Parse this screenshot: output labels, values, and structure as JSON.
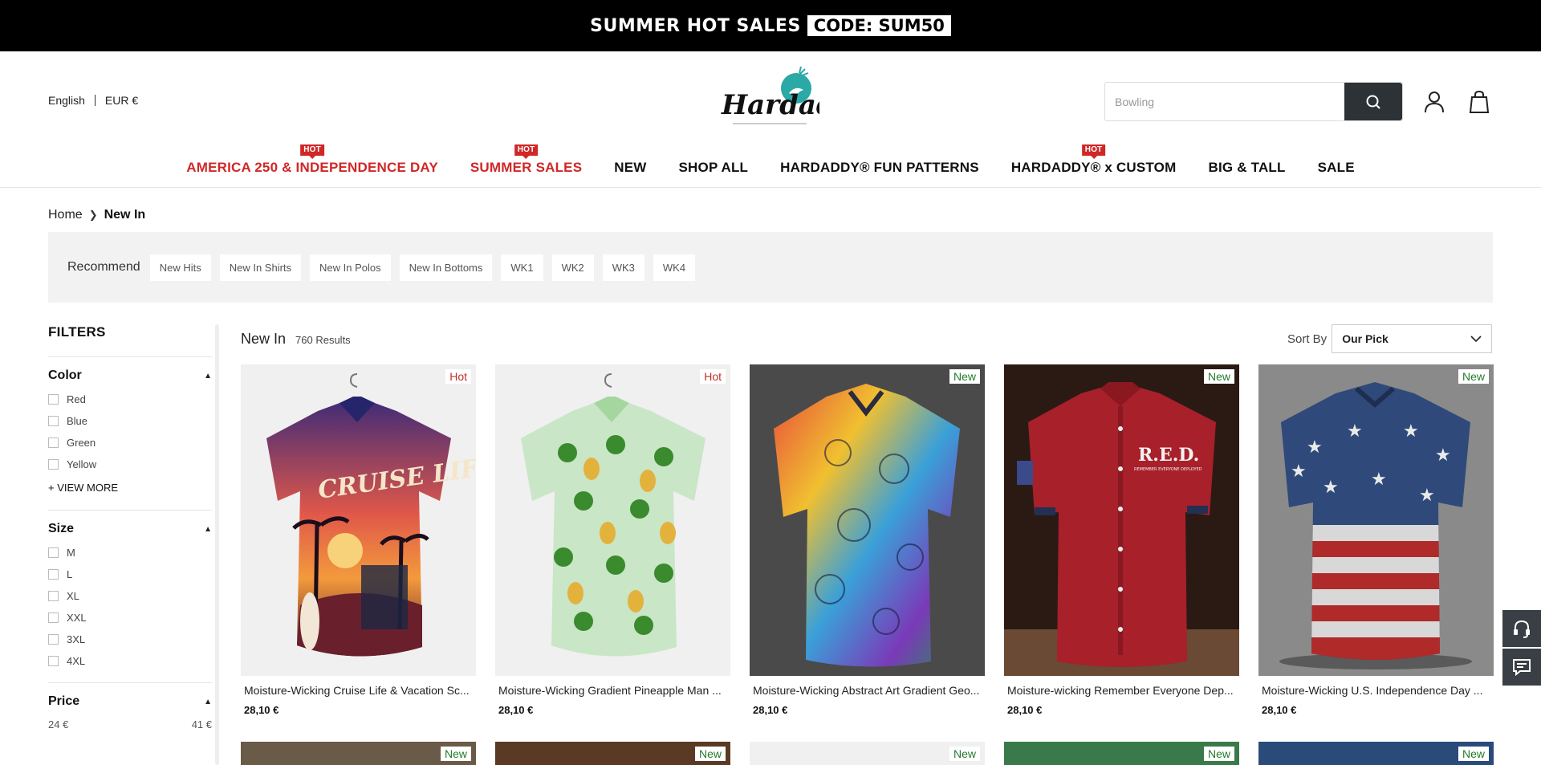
{
  "promo": {
    "text": "SUMMER HOT SALES",
    "code": "CODE: SUM50"
  },
  "header": {
    "language": "English",
    "currency": "EUR €",
    "logo_text": "Hardaddy",
    "search": {
      "placeholder": "Bowling"
    }
  },
  "nav": [
    {
      "label": "AMERICA 250 & INDEPENDENCE DAY",
      "hot": "HOT",
      "red": true
    },
    {
      "label": "SUMMER SALES",
      "hot": "HOT",
      "red": true
    },
    {
      "label": "NEW",
      "hot": "",
      "red": false
    },
    {
      "label": "SHOP ALL",
      "hot": "",
      "red": false
    },
    {
      "label": "HARDADDY® FUN PATTERNS",
      "hot": "",
      "red": false
    },
    {
      "label": "HARDADDY® x CUSTOM",
      "hot": "HOT",
      "red": false
    },
    {
      "label": "BIG & TALL",
      "hot": "",
      "red": false
    },
    {
      "label": "SALE",
      "hot": "",
      "red": false
    }
  ],
  "breadcrumb": {
    "home": "Home",
    "current": "New In"
  },
  "recommend": {
    "label": "Recommend",
    "chips": [
      "New Hits",
      "New In Shirts",
      "New In Polos",
      "New In Bottoms",
      "WK1",
      "WK2",
      "WK3",
      "WK4"
    ]
  },
  "filters": {
    "title": "FILTERS",
    "color": {
      "label": "Color",
      "options": [
        "Red",
        "Blue",
        "Green",
        "Yellow"
      ],
      "more": "+ VIEW MORE"
    },
    "size": {
      "label": "Size",
      "options": [
        "M",
        "L",
        "XL",
        "XXL",
        "3XL",
        "4XL"
      ]
    },
    "price": {
      "label": "Price",
      "min": "24 €",
      "max": "41 €"
    }
  },
  "results": {
    "heading": "New In",
    "count": "760 Results"
  },
  "sort": {
    "label": "Sort By",
    "value": "Our Pick"
  },
  "products": [
    {
      "name": "Moisture-Wicking Cruise Life & Vacation Sc...",
      "price": "28,10 €",
      "tag": "Hot",
      "tag_type": "hot"
    },
    {
      "name": "Moisture-Wicking Gradient Pineapple Man ...",
      "price": "28,10 €",
      "tag": "Hot",
      "tag_type": "hot"
    },
    {
      "name": "Moisture-Wicking Abstract Art Gradient Geo...",
      "price": "28,10 €",
      "tag": "New",
      "tag_type": "new"
    },
    {
      "name": "Moisture-wicking Remember Everyone Dep...",
      "price": "28,10 €",
      "tag": "New",
      "tag_type": "new"
    },
    {
      "name": "Moisture-Wicking U.S. Independence Day ...",
      "price": "28,10 €",
      "tag": "New",
      "tag_type": "new"
    }
  ],
  "products_row2_tags": [
    "New",
    "New",
    "New",
    "New",
    "New"
  ],
  "shirt_prints": {
    "cruise": "CRUISE LIFE",
    "red": "R.E.D.",
    "red_sub": "REMEMBER EVERYONE DEPLOYED"
  },
  "colors": {
    "accent_red": "#d02727",
    "new_green": "#237a2b",
    "topbar": "#000000",
    "search_btn": "#2d3237"
  }
}
